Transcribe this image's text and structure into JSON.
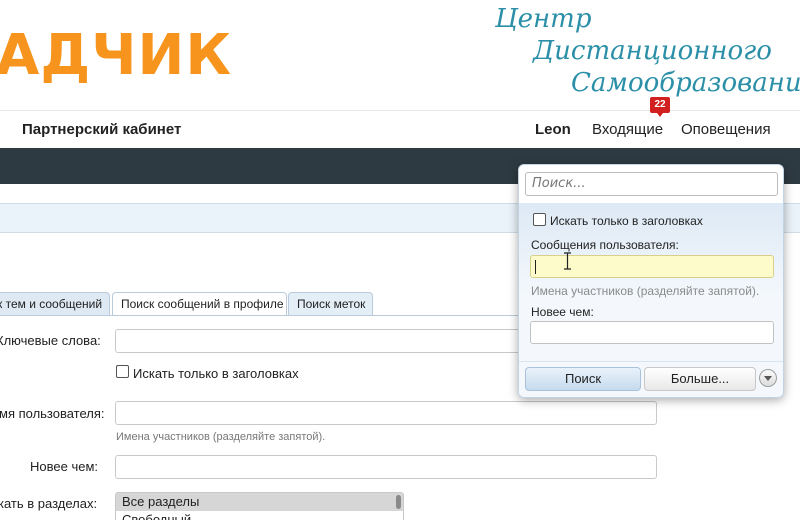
{
  "header": {
    "logo_text": "АДЧИК",
    "brand_lines": [
      "Центр",
      "Дистанционного",
      "Самообразования"
    ]
  },
  "nav": {
    "title": "Партнерский кабинет",
    "user": "Leon",
    "inbox": "Входящие",
    "inbox_badge": "22",
    "alerts": "Оповещения"
  },
  "tabs": [
    {
      "label": "к тем и сообщений"
    },
    {
      "label": "Поиск сообщений в профиле"
    },
    {
      "label": "Поиск меток"
    }
  ],
  "form": {
    "keywords_label": "Ключевые слова:",
    "titles_only_label": "Искать только в заголовках",
    "username_label": "мя пользователя:",
    "username_hint": "Имена участников (разделяйте запятой).",
    "newer_than_label": "Новее чем:",
    "sections_label": "кать в разделах:",
    "sections_options": [
      "Все разделы",
      "Свободный..."
    ]
  },
  "popup": {
    "search_placeholder": "Поиск...",
    "titles_only_label": "Искать только в заголовках",
    "user_messages_label": "Сообщения пользователя:",
    "user_messages_value": "",
    "hint": "Имена участников (разделяйте запятой).",
    "newer_than_label": "Новее чем:",
    "search_button": "Поиск",
    "more_button": "Больше..."
  },
  "colors": {
    "logo_orange": "#f7941d",
    "brand_teal": "#2b8fa8",
    "dark_bar": "#2e3a42",
    "badge_red": "#d21f1f",
    "active_field": "#fdfbc9"
  }
}
